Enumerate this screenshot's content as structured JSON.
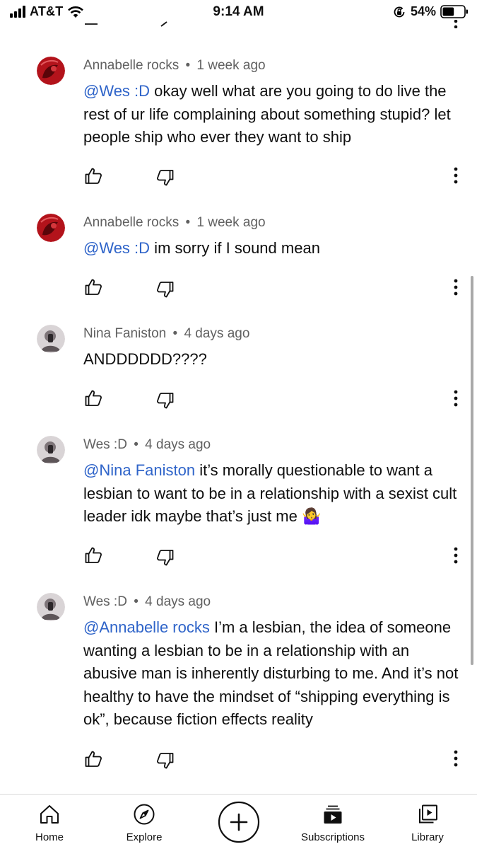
{
  "status_bar": {
    "carrier": "AT&T",
    "time": "9:14 AM",
    "battery": "54%",
    "battery_level": 0.54
  },
  "comments": [
    {
      "author": "Annabelle rocks",
      "age": "1 week ago",
      "mention": "@Wes :D",
      "text": " okay well what are you going to do live the rest of ur life complaining about something stupid? let people ship who ever they want to ship",
      "avatar": "red-avatar"
    },
    {
      "author": "Annabelle rocks",
      "age": "1 week ago",
      "mention": "@Wes :D",
      "text": " im sorry if I sound mean",
      "avatar": "red-avatar"
    },
    {
      "author": "Nina Faniston",
      "age": "4 days ago",
      "mention": "",
      "text": "ANDDDDDD????",
      "avatar": "photo-avatar"
    },
    {
      "author": "Wes :D",
      "age": "4 days ago",
      "mention": "@Nina Faniston",
      "text": " it’s morally questionable to want a lesbian to want to be in a relationship with a sexist cult leader idk maybe that’s just me 🤷‍♀️",
      "avatar": "photo-avatar"
    },
    {
      "author": "Wes :D",
      "age": "4 days ago",
      "mention": "@Annabelle rocks",
      "text": " I’m a lesbian, the idea of someone wanting a lesbian to be in a relationship with an abusive man is inherently disturbing to me. And it’s not healthy to have the mindset of “shipping everything is ok”, because fiction effects reality",
      "avatar": "photo-avatar"
    }
  ],
  "meta_separator": "•",
  "nav": {
    "home": "Home",
    "explore": "Explore",
    "subscriptions": "Subscriptions",
    "library": "Library"
  },
  "icons": {
    "like": "thumbs-up-icon",
    "dislike": "thumbs-down-icon",
    "more": "vertical-dots-icon",
    "create": "plus-circle-icon"
  },
  "colors": {
    "mention": "#2f64c9",
    "meta": "#606060",
    "avatar_red": "#b3131b"
  }
}
